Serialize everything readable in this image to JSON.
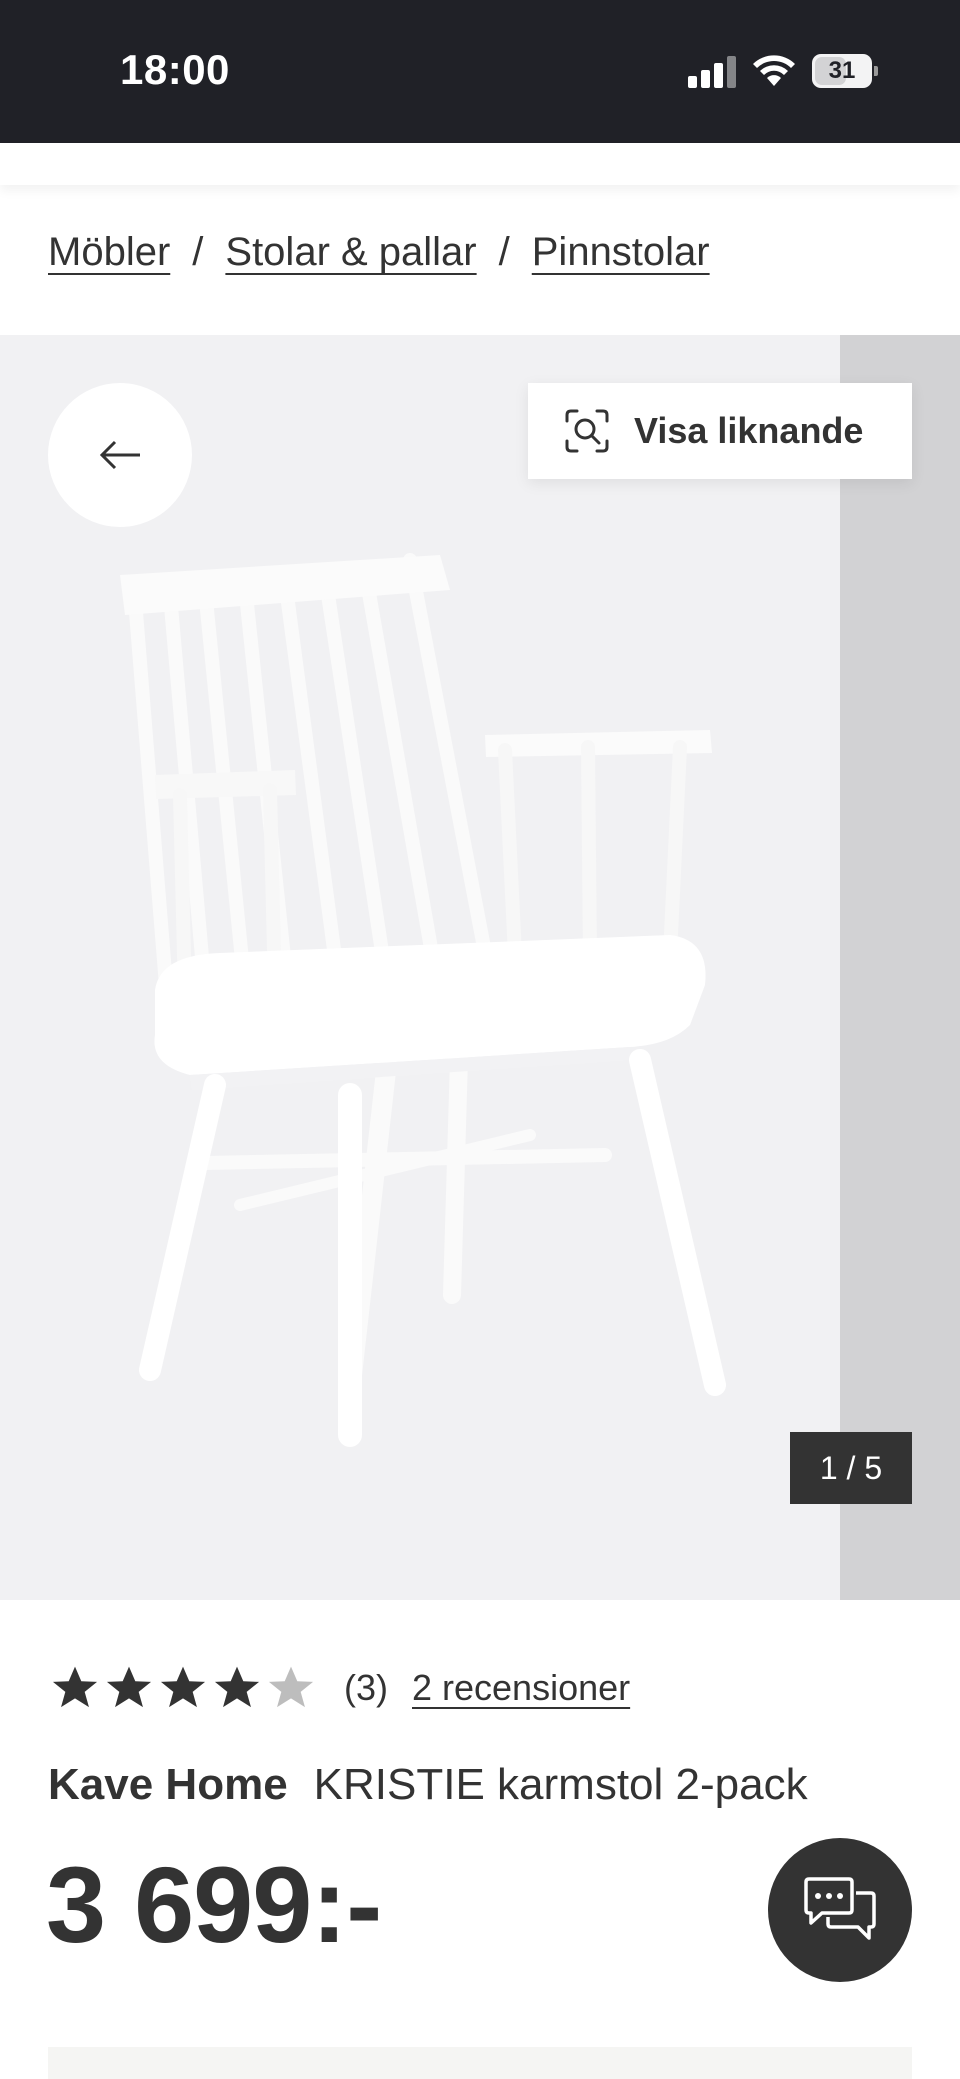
{
  "status_bar": {
    "time": "18:00",
    "battery": "31"
  },
  "breadcrumb": {
    "items": [
      "Möbler",
      "Stolar & pallar",
      "Pinnstolar"
    ],
    "separator": "/"
  },
  "gallery": {
    "similar_button_label": "Visa liknande",
    "counter": "1 / 5",
    "back_icon": "arrow-left-icon",
    "similar_icon": "visual-search-icon"
  },
  "rating": {
    "stars_value": 4,
    "stars_max": 5,
    "count": "(3)",
    "reviews_link": "2 recensioner"
  },
  "product": {
    "brand": "Kave Home",
    "name": "KRISTIE karmstol 2-pack",
    "price": "3 699:-"
  },
  "chat": {
    "icon": "chat-bubbles-icon"
  },
  "colors": {
    "status_bar_bg": "#202127",
    "text": "#333333",
    "star_filled": "#333333",
    "star_empty": "#bdbdbd"
  }
}
